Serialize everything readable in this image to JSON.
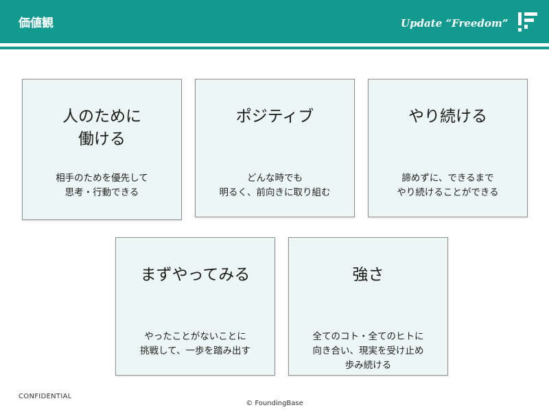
{
  "header": {
    "title": "価値観",
    "tagline": "Update “Freedom”",
    "logo_icon": "founding-base-logo"
  },
  "values": [
    {
      "title_lines": [
        "人のために",
        "働ける"
      ],
      "desc_lines": [
        "相手のためを優先して",
        "思考・行動できる"
      ]
    },
    {
      "title_lines": [
        "ポジティブ"
      ],
      "desc_lines": [
        "どんな時でも",
        "明るく、前向きに取り組む"
      ]
    },
    {
      "title_lines": [
        "やり続ける"
      ],
      "desc_lines": [
        "諦めずに、できるまで",
        "やり続けることができる"
      ]
    },
    {
      "title_lines": [
        "まずやってみる"
      ],
      "desc_lines": [
        "やったことがないことに",
        "挑戦して、一歩を踏み出す"
      ]
    },
    {
      "title_lines": [
        "強さ"
      ],
      "desc_lines": [
        "全てのコト・全てのヒトに",
        "向き合い、現実を受け止め",
        "歩み続ける"
      ]
    }
  ],
  "footer": {
    "confidential": "CONFIDENTIAL",
    "copyright": "© FoundingBase"
  },
  "colors": {
    "brand": "#139a8e",
    "card_background": "#ebf6f5",
    "card_border": "#8f8f8f"
  }
}
